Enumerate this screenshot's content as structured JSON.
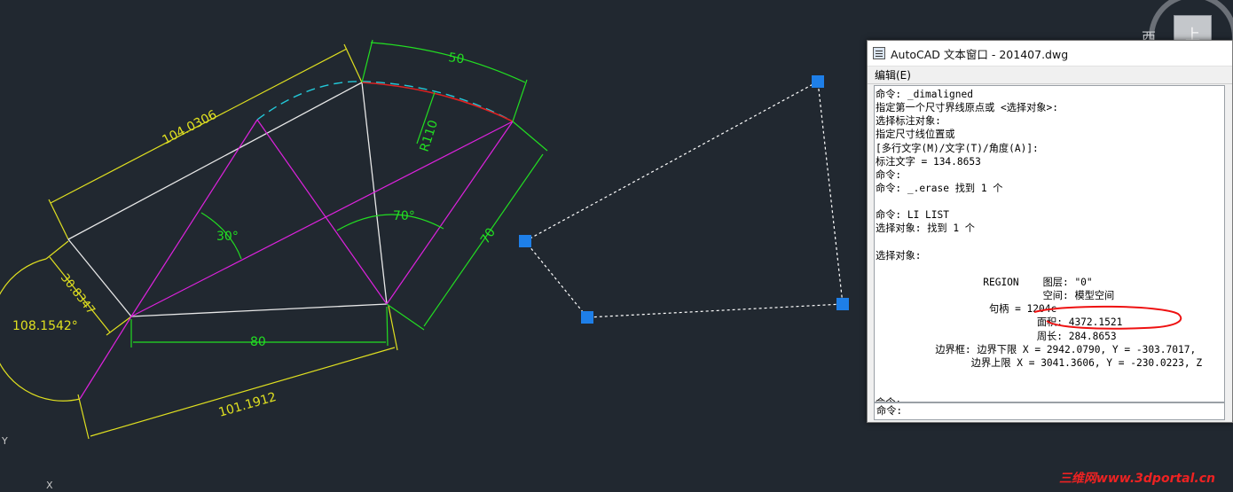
{
  "window": {
    "title": "AutoCAD 文本窗口 - 201407.dwg",
    "menu_edit": "编辑(E)"
  },
  "console_lines": [
    "命令: _dimaligned",
    "指定第一个尺寸界线原点或 <选择对象>:",
    "选择标注对象:",
    "指定尺寸线位置或",
    "[多行文字(M)/文字(T)/角度(A)]:",
    "标注文字 = 134.8653",
    "命令:",
    "命令: _.erase 找到 1 个",
    "",
    "命令: LI LIST",
    "选择对象: 找到 1 个",
    "",
    "选择对象:",
    "",
    "                  REGION    图层: \"0\"",
    "                            空间: 模型空间",
    "                   句柄 = 1204c",
    "                           面积: 4372.1521",
    "                           周长: 284.8653",
    "          边界框: 边界下限 X = 2942.0790, Y = -303.7017,",
    "                边界上限 X = 3041.3606, Y = -230.0223, Z",
    "",
    "",
    "命令:"
  ],
  "command_prompt": "命令:",
  "annotations": {
    "area_highlight_color": "#ee1111"
  },
  "drawing": {
    "dimensions": {
      "aligned_top": "104.0306",
      "arc_length": "50",
      "radius": "R110",
      "right_side": "70",
      "angle_left": "30°",
      "angle_mid": "70°",
      "left_short": "30.8347",
      "left_angle": "108.1542°",
      "bottom_inner": "80",
      "bottom_outer": "101.1912"
    },
    "colors": {
      "background": "#212830",
      "dimension_yellow": "#e0e020",
      "dimension_green": "#22dd22",
      "construction_magenta": "#dd22dd",
      "geometry_white": "#e8e8e8",
      "arc_red": "#dd2222",
      "arc_cyan_dashed": "#22c8d8",
      "grip_blue": "#1e7fe8"
    }
  },
  "viewcube": {
    "top_face": "上",
    "west": "西"
  },
  "ucs": {
    "y": "Y",
    "x": "X"
  },
  "watermark": "三维网www.3dportal.cn"
}
